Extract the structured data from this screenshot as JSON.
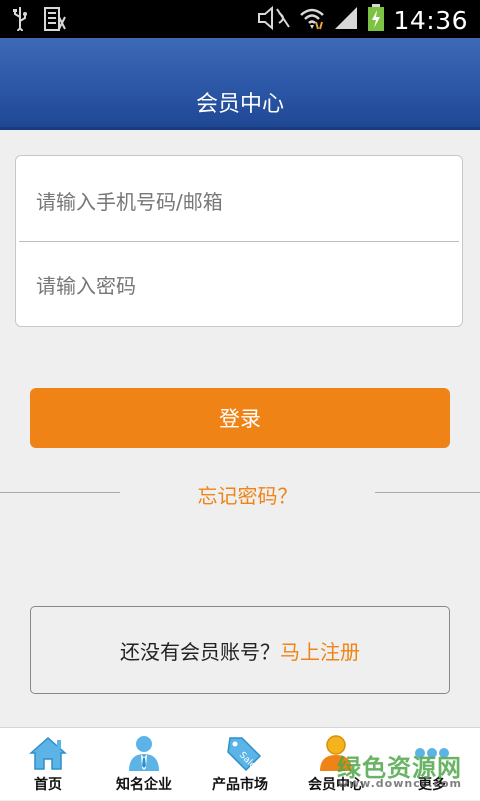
{
  "status_bar": {
    "time": "14:36",
    "icons": [
      "usb-icon",
      "sim-icon",
      "mute-icon",
      "wifi-icon",
      "signal-icon",
      "battery-charging-icon"
    ]
  },
  "header": {
    "title": "会员中心"
  },
  "login": {
    "account_placeholder": "请输入手机号码/邮箱",
    "password_placeholder": "请输入密码",
    "login_button": "登录",
    "forgot_password": "忘记密码？"
  },
  "register": {
    "prompt": "还没有会员账号？",
    "link": "马上注册"
  },
  "bottom_nav": {
    "items": [
      {
        "label": "首页",
        "icon": "home-icon"
      },
      {
        "label": "知名企业",
        "icon": "businessman-icon"
      },
      {
        "label": "产品市场",
        "icon": "sale-tag-icon"
      },
      {
        "label": "会员中心",
        "icon": "member-icon"
      },
      {
        "label": "更多",
        "icon": "more-icon"
      }
    ]
  },
  "watermark": {
    "text": "绿色资源网",
    "sub": "www.downcc.com"
  },
  "colors": {
    "accent": "#f08316",
    "header": "#2c57a7",
    "icon_blue": "#4aa7de"
  }
}
